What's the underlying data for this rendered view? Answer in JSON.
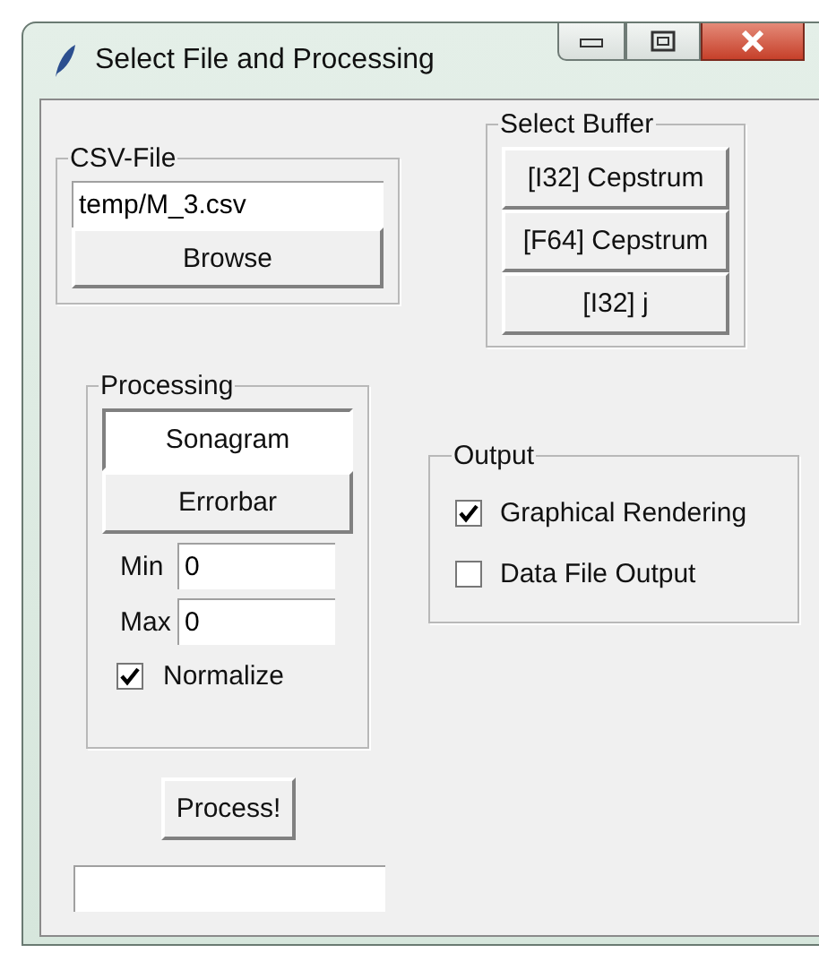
{
  "window": {
    "title": "Select File and Processing"
  },
  "csv_file": {
    "title": "CSV-File",
    "path": "temp/M_3.csv",
    "browse": "Browse"
  },
  "select_buffer": {
    "title": "Select Buffer",
    "buttons": [
      "[I32] Cepstrum",
      "[F64] Cepstrum",
      "[I32] j"
    ]
  },
  "processing": {
    "title": "Processing",
    "modes": [
      {
        "label": "Sonagram",
        "selected": true
      },
      {
        "label": "Errorbar",
        "selected": false
      }
    ],
    "min": {
      "label": "Min",
      "value": "0"
    },
    "max": {
      "label": "Max",
      "value": "0"
    },
    "normalize": {
      "label": "Normalize",
      "checked": true
    }
  },
  "output": {
    "title": "Output",
    "options": [
      {
        "label": "Graphical Rendering",
        "checked": true
      },
      {
        "label": "Data File Output",
        "checked": false
      }
    ]
  },
  "process_button": "Process!"
}
